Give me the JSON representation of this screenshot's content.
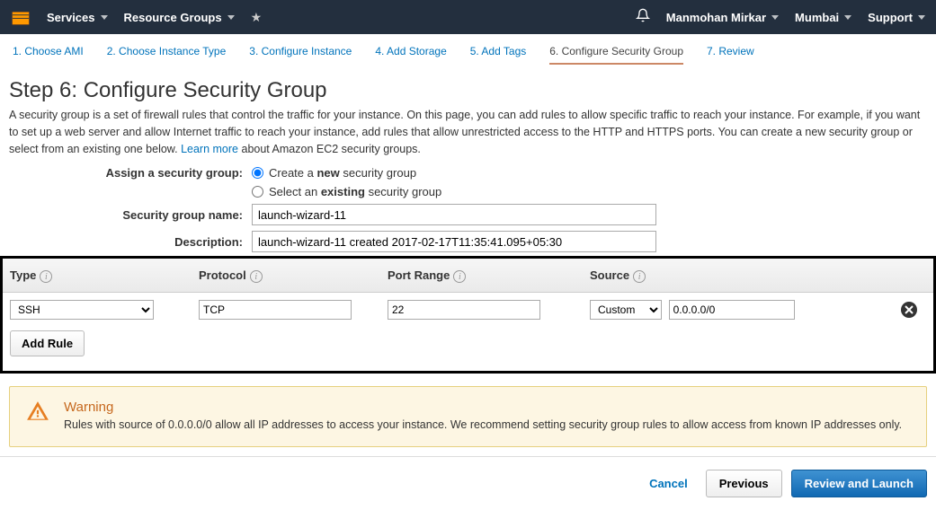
{
  "topnav": {
    "services": "Services",
    "resource_groups": "Resource Groups",
    "user": "Manmohan Mirkar",
    "region": "Mumbai",
    "support": "Support"
  },
  "wizard": {
    "tabs": [
      "1. Choose AMI",
      "2. Choose Instance Type",
      "3. Configure Instance",
      "4. Add Storage",
      "5. Add Tags",
      "6. Configure Security Group",
      "7. Review"
    ],
    "active_index": 5
  },
  "page": {
    "title": "Step 6: Configure Security Group",
    "description_pre": "A security group is a set of firewall rules that control the traffic for your instance. On this page, you can add rules to allow specific traffic to reach your instance. For example, if you want to set up a web server and allow Internet traffic to reach your instance, add rules that allow unrestricted access to the HTTP and HTTPS ports. You can create a new security group or select from an existing one below. ",
    "learn_more": "Learn more",
    "description_post": " about Amazon EC2 security groups."
  },
  "form": {
    "assign_label": "Assign a security group:",
    "radio_create_pre": "Create a ",
    "radio_create_bold": "new",
    "radio_create_post": " security group",
    "radio_select_pre": "Select an ",
    "radio_select_bold": "existing",
    "radio_select_post": " security group",
    "sg_name_label": "Security group name:",
    "sg_name_value": "launch-wizard-11",
    "description_label": "Description:",
    "description_value": "launch-wizard-11 created 2017-02-17T11:35:41.095+05:30"
  },
  "rules": {
    "headers": {
      "type": "Type",
      "protocol": "Protocol",
      "port_range": "Port Range",
      "source": "Source"
    },
    "rows": [
      {
        "type": "SSH",
        "protocol": "TCP",
        "port_range": "22",
        "source_mode": "Custom",
        "source_value": "0.0.0.0/0"
      }
    ],
    "add_rule_label": "Add Rule"
  },
  "warning": {
    "title": "Warning",
    "text": "Rules with source of 0.0.0.0/0 allow all IP addresses to access your instance. We recommend setting security group rules to allow access from known IP addresses only."
  },
  "footer": {
    "cancel": "Cancel",
    "previous": "Previous",
    "review": "Review and Launch"
  }
}
